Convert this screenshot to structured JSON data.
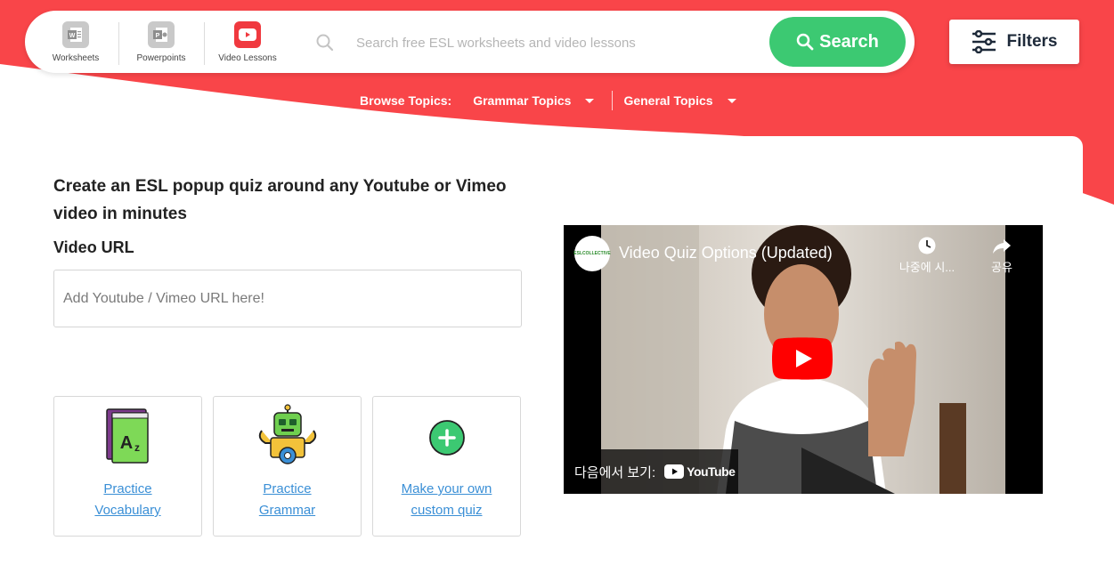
{
  "colors": {
    "brand_red": "#f94549",
    "search_green": "#3cc972",
    "link_blue": "#3a8fd6",
    "filters_text": "#1e2a3a"
  },
  "header": {
    "types": [
      {
        "label": "Worksheets",
        "icon": "word-doc-icon"
      },
      {
        "label": "Powerpoints",
        "icon": "powerpoint-icon"
      },
      {
        "label": "Video Lessons",
        "icon": "youtube-icon",
        "active": true
      }
    ],
    "search_placeholder": "Search free ESL worksheets and video lessons",
    "search_button": "Search",
    "filters_button": "Filters"
  },
  "browse": {
    "label": "Browse Topics:",
    "grammar": "Grammar Topics",
    "general": "General Topics"
  },
  "main": {
    "headline": "Create an ESL popup quiz around any Youtube or Vimeo video in minutes",
    "url_label": "Video URL",
    "url_placeholder": "Add Youtube / Vimeo URL here!",
    "options": [
      {
        "line1": "Practice",
        "line2": "Vocabulary",
        "icon": "vocabulary-book-icon"
      },
      {
        "line1": "Practice",
        "line2": "Grammar",
        "icon": "grammar-robot-icon"
      },
      {
        "line1": "Make your own",
        "line2": "custom quiz",
        "icon": "plus-circle-icon"
      }
    ]
  },
  "video": {
    "title": "Video Quiz Options (Updated)",
    "channel_logo_text": "ESLCOLLECTIVE",
    "watch_later": "나중에 시...",
    "share": "공유",
    "watch_on": "다음에서 보기:",
    "youtube_brand": "YouTube"
  }
}
